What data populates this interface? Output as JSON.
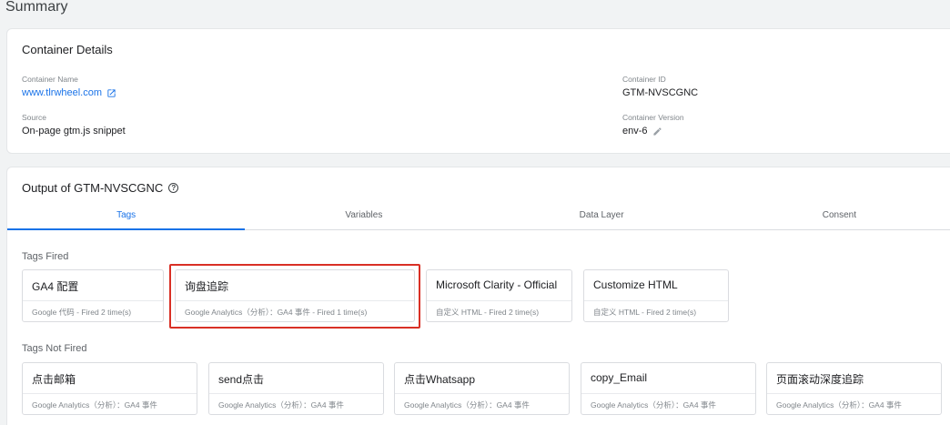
{
  "page": {
    "title": "Summary"
  },
  "container_details": {
    "title": "Container Details",
    "container_name_label": "Container Name",
    "container_name_value": "www.tlrwheel.com",
    "source_label": "Source",
    "source_value": "On-page gtm.js snippet",
    "container_id_label": "Container ID",
    "container_id_value": "GTM-NVSCGNC",
    "container_version_label": "Container Version",
    "container_version_value": "env-6"
  },
  "output": {
    "title": "Output of GTM-NVSCGNC",
    "tabs": [
      {
        "label": "Tags",
        "active": true
      },
      {
        "label": "Variables",
        "active": false
      },
      {
        "label": "Data Layer",
        "active": false
      },
      {
        "label": "Consent",
        "active": false
      }
    ],
    "tags_fired_label": "Tags Fired",
    "tags_fired": [
      {
        "name": "GA4 配置",
        "meta": "Google 代码 - Fired 2 time(s)"
      },
      {
        "name": "询盘追踪",
        "meta": "Google Analytics（分析）：GA4 事件 - Fired 1 time(s)",
        "highlighted": true
      },
      {
        "name": "Microsoft Clarity - Official",
        "meta": "自定义 HTML - Fired 2 time(s)"
      },
      {
        "name": "Customize HTML",
        "meta": "自定义 HTML - Fired 2 time(s)"
      }
    ],
    "tags_not_fired_label": "Tags Not Fired",
    "tags_not_fired": [
      {
        "name": "点击邮箱",
        "meta": "Google Analytics（分析）：GA4 事件"
      },
      {
        "name": "send点击",
        "meta": "Google Analytics（分析）：GA4 事件"
      },
      {
        "name": "点击Whatsapp",
        "meta": "Google Analytics（分析）：GA4 事件"
      },
      {
        "name": "copy_Email",
        "meta": "Google Analytics（分析）：GA4 事件"
      },
      {
        "name": "页面滚动深度追踪",
        "meta": "Google Analytics（分析）：GA4 事件"
      }
    ]
  },
  "colors": {
    "accent": "#1a73e8",
    "highlight": "#d93025"
  },
  "icons": {
    "external_link": "open-in-new-icon",
    "edit": "pencil-icon",
    "help": "help-icon"
  }
}
